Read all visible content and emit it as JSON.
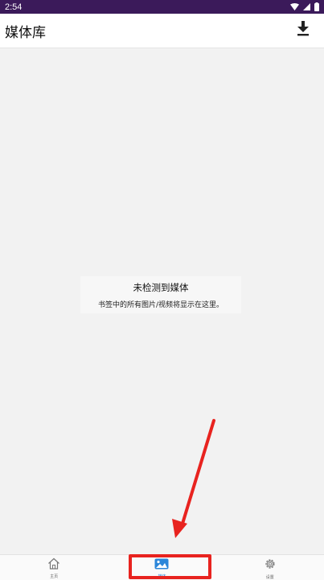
{
  "status_bar": {
    "time": "2:54"
  },
  "app_bar": {
    "title": "媒体库",
    "download_icon": "download-icon"
  },
  "empty_state": {
    "title": "未检测到媒体",
    "description": "书签中的所有图片/视频将显示在这里。"
  },
  "bottom_nav": {
    "items": [
      {
        "label": "主页",
        "icon": "home-icon",
        "active": false
      },
      {
        "label": "媒体",
        "icon": "image-icon",
        "active": true
      },
      {
        "label": "设置",
        "icon": "gear-icon",
        "active": false
      }
    ]
  },
  "colors": {
    "status_bar": "#3b1a5a",
    "accent": "#2b86d9",
    "highlight": "#e8231f"
  }
}
